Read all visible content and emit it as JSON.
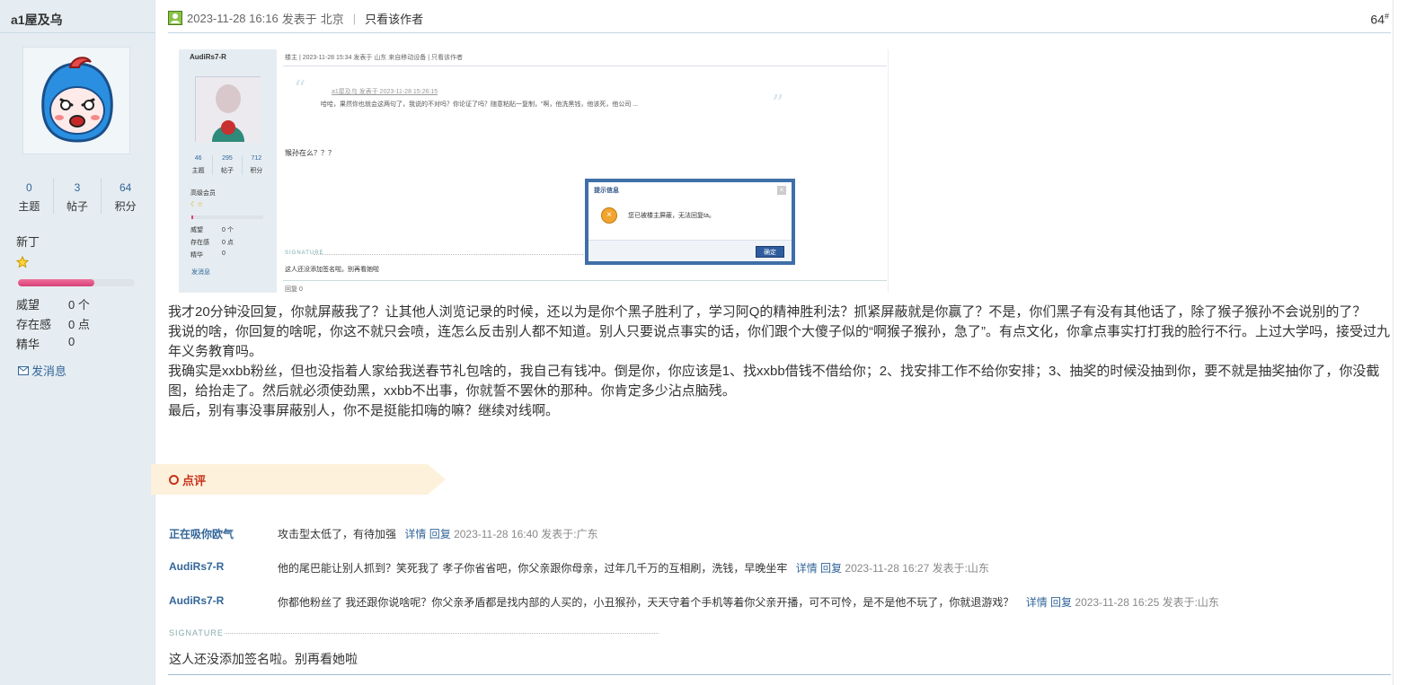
{
  "user": {
    "name": "a1屋及乌",
    "stats": [
      {
        "num": "0",
        "label": "主题"
      },
      {
        "num": "3",
        "label": "帖子"
      },
      {
        "num": "64",
        "label": "积分"
      }
    ],
    "rank": "新丁",
    "meta": [
      {
        "label": "威望",
        "value": "0 个"
      },
      {
        "label": "存在感",
        "value": "0 点"
      },
      {
        "label": "精华",
        "value": "0"
      }
    ],
    "pm_label": "发消息"
  },
  "post": {
    "datetime": "2023-11-28 16:16",
    "posted_in_prefix": "发表于",
    "location": "北京",
    "author_only": "只看该作者",
    "floor": "64",
    "floor_suffix": "#",
    "paragraphs": [
      "我才20分钟没回复，你就屏蔽我了？让其他人浏览记录的时候，还以为是你个黑子胜利了，学习阿Q的精神胜利法？抓紧屏蔽就是你赢了？不是，你们黑子有没有其他话了，除了猴子猴孙不会说别的了？",
      "我说的啥，你回复的啥呢，你这不就只会喷，连怎么反击别人都不知道。别人只要说点事实的话，你们跟个大傻子似的“啊猴子猴孙，急了”。有点文化，你拿点事实打打我的脸行不行。上过大学吗，接受过九年义务教育吗。",
      "我确实是xxbb粉丝，但也没指着人家给我送春节礼包啥的，我自己有钱冲。倒是你，你应该是1、找xxbb借钱不借给你；2、找安排工作不给你安排；3、抽奖的时候没抽到你，要不就是抽奖抽你了，你没截图，给抬走了。然后就必须使劲黑，xxbb不出事，你就誓不罢休的那种。你肯定多少沾点脑残。",
      "最后，别有事没事屏蔽别人，你不是挺能扣嗨的嘛？继续对线啊。"
    ]
  },
  "screenshot": {
    "name": "AudiRs7-R",
    "stats": [
      {
        "num": "46",
        "label": "主题"
      },
      {
        "num": "295",
        "label": "帖子"
      },
      {
        "num": "712",
        "label": "积分"
      }
    ],
    "rank": "高级会员",
    "meta": [
      {
        "label": "威望",
        "value": "0 个"
      },
      {
        "label": "存在感",
        "value": "0 点"
      },
      {
        "label": "精华",
        "value": "0"
      }
    ],
    "pm_label": "发消息",
    "header": "楼主 | 2023-11-28 15:34 发表于 山东 来自移动设备 | 只看该作者",
    "quote_head": "a1屋及乌 发表于 2023-11-28 15:26:15",
    "quote_body": "哈哈，果然你也就会这两句了，我说的不对吗？你论证了吗？随意粘贴一复制，“啊，他洗黑钱，他该死，他公司 ...",
    "body": "猴孙在么？？？",
    "signature_label": "SIGNATURE",
    "signature_text": "这人还没添加签名啦。别再看她啦",
    "footer": "回复  0",
    "dialog": {
      "title": "提示信息",
      "message": "您已被楼主屏蔽，无法回复ta。",
      "ok": "确定"
    }
  },
  "review": {
    "label": "点评",
    "comments": [
      {
        "user": "正在吸你欧气",
        "text": "攻击型太低了，有待加强",
        "detail": "详情",
        "reply": "回复",
        "time": "2023-11-28 16:40 发表于:广东"
      },
      {
        "user": "AudiRs7-R",
        "text": "他的尾巴能让别人抓到？笑死我了 孝子你省省吧，你父亲跟你母亲，过年几千万的互相刷，洗钱，早晚坐牢",
        "detail": "详情",
        "reply": "回复",
        "time": "2023-11-28 16:27 发表于:山东"
      },
      {
        "user": "AudiRs7-R",
        "text": "你都他粉丝了 我还跟你说啥呢？你父亲矛盾都是找内部的人买的，小丑猴孙，天天守着个手机等着你父亲开播，可不可怜，是不是他不玩了，你就退游戏？",
        "detail": "详情",
        "reply": "回复",
        "time": "2023-11-28 16:25 发表于:山东"
      }
    ]
  },
  "signature": {
    "label": "SIGNATURE",
    "text": "这人还没添加签名啦。别再看她啦"
  },
  "colors": {
    "sidebar_bg": "#e5edf2",
    "link": "#336699",
    "review_red": "#c9331c",
    "review_tab_bg": "#fdf1dc"
  }
}
